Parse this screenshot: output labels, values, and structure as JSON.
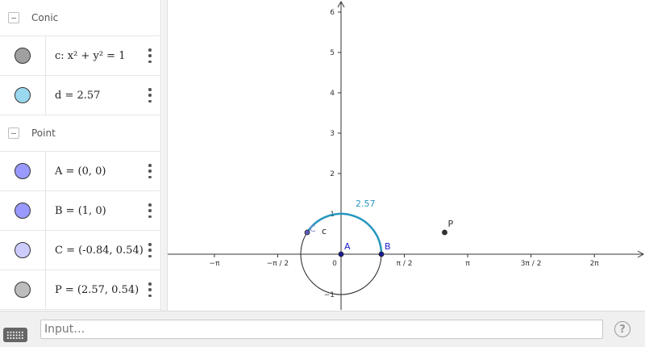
{
  "algebra": {
    "groups": [
      {
        "title": "Conic",
        "items": [
          {
            "text": "c: x² + y² = 1",
            "color": "#a0a0a0"
          },
          {
            "text": "d = 2.57",
            "color": "#99d8ef"
          }
        ]
      },
      {
        "title": "Point",
        "items": [
          {
            "text": "A = (0, 0)",
            "color": "#9999ff"
          },
          {
            "text": "B = (1, 0)",
            "color": "#9999ff"
          },
          {
            "text": "C = (-0.84, 0.54)",
            "color": "#ccccff"
          },
          {
            "text": "P = (2.57, 0.54)",
            "color": "#bdbdbd"
          }
        ]
      }
    ]
  },
  "graphics": {
    "x_ticks": [
      {
        "value": -3.14159,
        "label": "−π"
      },
      {
        "value": -1.5708,
        "label": "−π / 2"
      },
      {
        "value": 1.5708,
        "label": "π / 2"
      },
      {
        "value": 3.14159,
        "label": "π"
      },
      {
        "value": 4.71239,
        "label": "3π / 2"
      },
      {
        "value": 6.28319,
        "label": "2π"
      }
    ],
    "origin_label": "0",
    "y_ticks": [
      {
        "value": -1,
        "label": "−1"
      },
      {
        "value": 1,
        "label": "1"
      },
      {
        "value": 2,
        "label": "2"
      },
      {
        "value": 3,
        "label": "3"
      },
      {
        "value": 4,
        "label": "4"
      },
      {
        "value": 5,
        "label": "5"
      },
      {
        "value": 6,
        "label": "6"
      }
    ],
    "circle_label": "c",
    "arc_label": "2.57",
    "arc_value": 2.57,
    "points": [
      {
        "name": "A",
        "x": 0,
        "y": 0,
        "color": "#1a1a99"
      },
      {
        "name": "B",
        "x": 1,
        "y": 0,
        "color": "#1a1a99"
      },
      {
        "name": "C",
        "x": -0.84,
        "y": 0.54,
        "color": "#5c5cbf"
      },
      {
        "name": "P",
        "x": 2.57,
        "y": 0.54,
        "color": "#333333"
      }
    ],
    "arc_color": "#2596be",
    "point_label_color_AB": "#1a1acc",
    "point_label_color_C": "#8888cc"
  },
  "input": {
    "placeholder": "Input…",
    "help_symbol": "?"
  },
  "icons": {
    "keyboard": "keyboard-icon",
    "help": "help-icon"
  }
}
